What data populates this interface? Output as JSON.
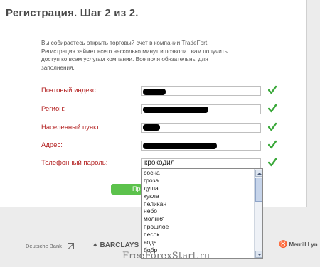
{
  "header": {
    "title": "Регистрация. Шаг 2 из 2."
  },
  "intro": {
    "text": "Вы собираетесь открыть торговый счет в компании TradeFort. Регистрация займет всего несколько минут и позволит вам получить доступ ко всем услугам компании. Все поля обязательны для заполнения."
  },
  "form": {
    "fields": [
      {
        "label": "Почтовый индекс:"
      },
      {
        "label": "Регион:"
      },
      {
        "label": "Населенный пункт:"
      },
      {
        "label": "Адрес:"
      },
      {
        "label": "Телефонный пароль:",
        "value": "крокодил"
      }
    ],
    "submit_label": "Пр"
  },
  "dropdown": {
    "options": [
      "сосна",
      "гроза",
      "душа",
      "кукла",
      "пеликан",
      "небо",
      "молния",
      "прошлое",
      "песок",
      "вода",
      "бобр"
    ]
  },
  "partners": {
    "deutsche": "Deutsche Bank",
    "barclays": "BARCLAYS",
    "merrill": "Merrill Lyn"
  },
  "watermark": "FreeForexStart.ru",
  "colors": {
    "label_red": "#b32020",
    "check_green": "#3aa83a",
    "button_green": "#5cc24c"
  }
}
